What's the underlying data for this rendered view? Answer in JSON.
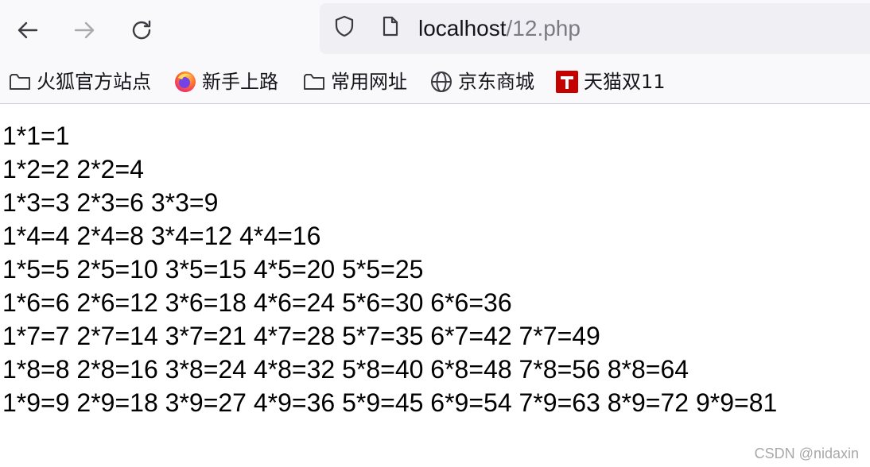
{
  "browser": {
    "url_host": "localhost",
    "url_path": "/12.php",
    "bookmarks": [
      {
        "label": "火狐官方站点",
        "icon": "folder-icon"
      },
      {
        "label": "新手上路",
        "icon": "firefox-icon"
      },
      {
        "label": "常用网址",
        "icon": "folder-icon"
      },
      {
        "label": "京东商城",
        "icon": "globe-icon"
      },
      {
        "label": "天猫双11",
        "icon": "tmall-icon"
      }
    ],
    "colors": {
      "toolbar": "#f9f9fb",
      "urlbar": "#f0f0f4",
      "tmall": "#c40000"
    }
  },
  "page": {
    "lines": [
      "1*1=1",
      "1*2=2 2*2=4",
      "1*3=3 2*3=6 3*3=9",
      "1*4=4 2*4=8 3*4=12 4*4=16",
      "1*5=5 2*5=10 3*5=15 4*5=20 5*5=25",
      "1*6=6 2*6=12 3*6=18 4*6=24 5*6=30 6*6=36",
      "1*7=7 2*7=14 3*7=21 4*7=28 5*7=35 6*7=42 7*7=49",
      "1*8=8 2*8=16 3*8=24 4*8=32 5*8=40 6*8=48 7*8=56 8*8=64",
      "1*9=9 2*9=18 3*9=27 4*9=36 5*9=45 6*9=54 7*9=63 8*9=72 9*9=81"
    ]
  },
  "watermark": "CSDN @nidaxin"
}
